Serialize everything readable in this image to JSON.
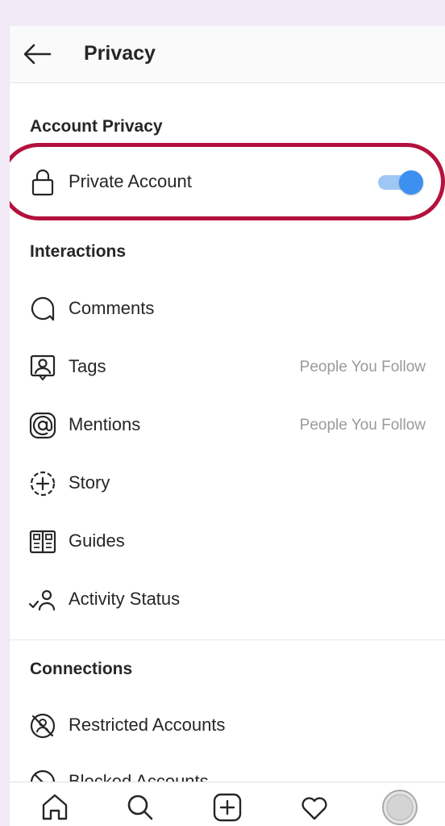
{
  "header": {
    "title": "Privacy",
    "back_icon": "arrow-left-icon"
  },
  "account_privacy": {
    "section_title": "Account Privacy",
    "private_account": {
      "label": "Private Account",
      "icon": "lock-icon",
      "enabled": true,
      "accent": "#3d8ff0"
    }
  },
  "interactions": {
    "section_title": "Interactions",
    "items": [
      {
        "label": "Comments",
        "icon": "comment-icon",
        "value": ""
      },
      {
        "label": "Tags",
        "icon": "tag-person-icon",
        "value": "People You Follow"
      },
      {
        "label": "Mentions",
        "icon": "at-sign-icon",
        "value": "People You Follow"
      },
      {
        "label": "Story",
        "icon": "story-add-icon",
        "value": ""
      },
      {
        "label": "Guides",
        "icon": "guides-icon",
        "value": ""
      },
      {
        "label": "Activity Status",
        "icon": "activity-status-icon",
        "value": ""
      }
    ]
  },
  "connections": {
    "section_title": "Connections",
    "items": [
      {
        "label": "Restricted Accounts",
        "icon": "restricted-icon"
      },
      {
        "label": "Blocked Accounts",
        "icon": "blocked-icon"
      }
    ]
  },
  "tabbar": {
    "items": [
      "home-icon",
      "search-icon",
      "add-post-icon",
      "heart-icon",
      "profile-avatar"
    ]
  },
  "colors": {
    "highlight_outline": "#b3123d",
    "toggle_knob": "#3d8ff0",
    "toggle_track": "#9fc7f3",
    "secondary_text": "#9a9a9a"
  }
}
